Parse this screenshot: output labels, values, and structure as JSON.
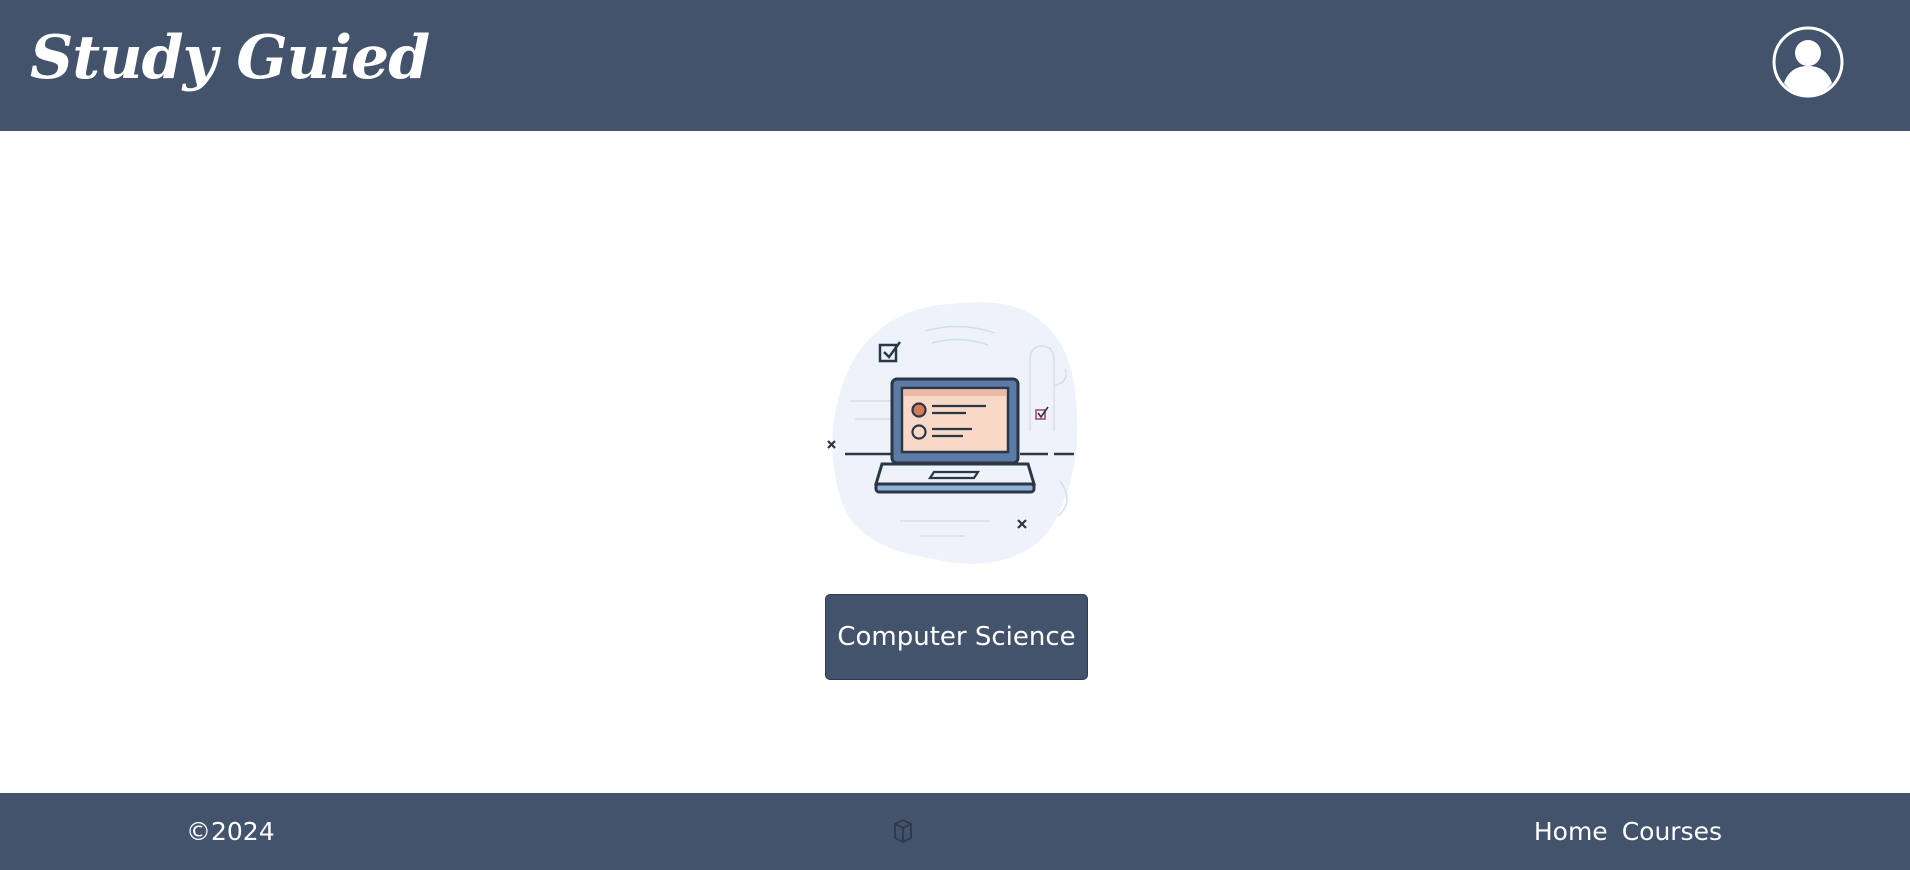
{
  "header": {
    "logo_text": "Study Guied",
    "background_color": "#43536c",
    "profile_icon": "user-circle-icon"
  },
  "main": {
    "illustration_icon": "laptop-checklist-illustration",
    "course_button_label": "Computer Science"
  },
  "footer": {
    "copyright": "©2024",
    "center_icon": "cube-icon",
    "links": [
      {
        "label": "Home"
      },
      {
        "label": "Courses"
      }
    ]
  }
}
